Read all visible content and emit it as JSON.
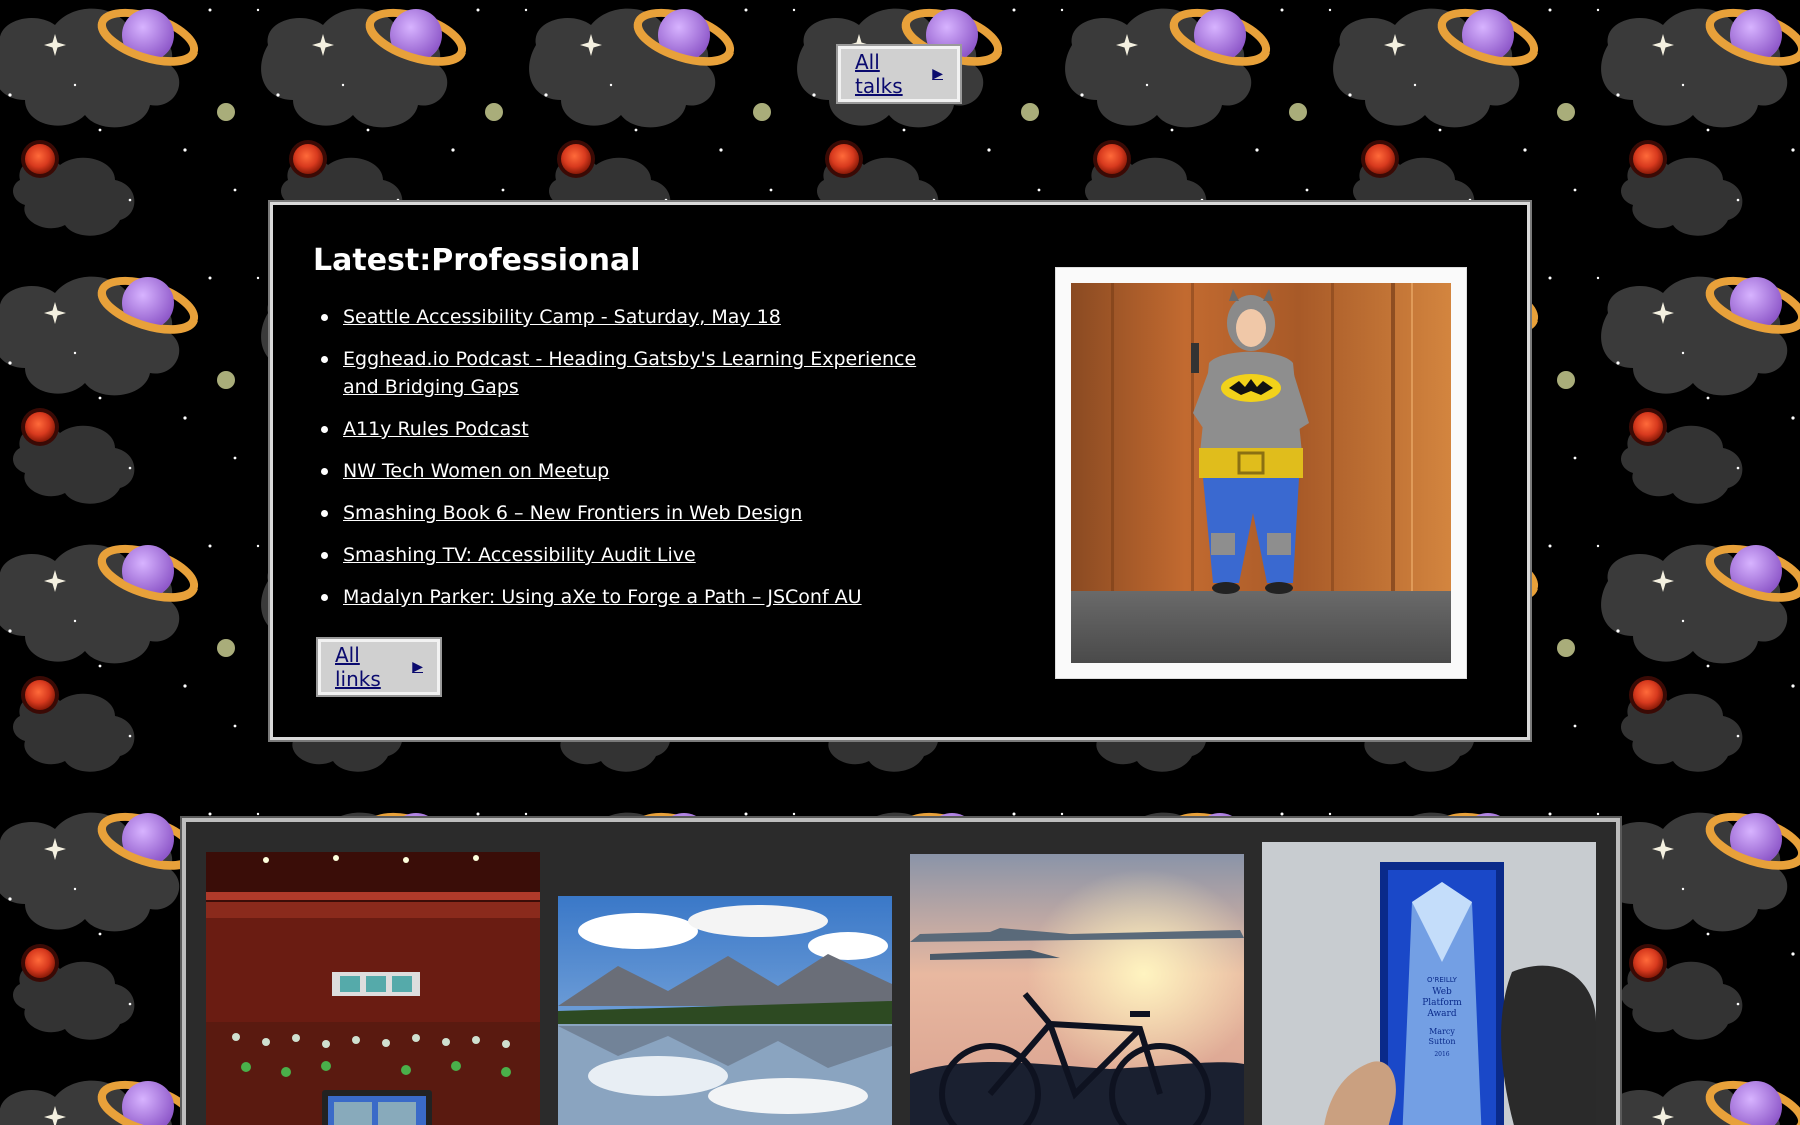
{
  "nav": {
    "all_talks_label": "All talks",
    "all_talks_arrow": "▶"
  },
  "latest": {
    "title": "Latest:Professional",
    "items": [
      {
        "label": "Seattle Accessibility Camp - Saturday, May 18"
      },
      {
        "label": "Egghead.io Podcast - Heading Gatsby's Learning Experience and Bridging Gaps"
      },
      {
        "label": "A11y Rules Podcast"
      },
      {
        "label": "NW Tech Women on Meetup"
      },
      {
        "label": "Smashing Book 6 – New Frontiers in Web Design"
      },
      {
        "label": "Smashing TV: Accessibility Audit Live"
      },
      {
        "label": "Madalyn Parker: Using aXe to Forge a Path – JSConf AU"
      }
    ],
    "all_links_label": "All links",
    "all_links_arrow": "▶",
    "photo_alt": "batman-costume-photo"
  },
  "gallery": {
    "images": [
      {
        "name": "theater-audience-photo"
      },
      {
        "name": "mountain-lake-photo"
      },
      {
        "name": "bicycle-sunset-photo"
      },
      {
        "name": "award-trophy-photo",
        "engraving": [
          "O'REILLY",
          "Web",
          "Platform",
          "Award",
          "Marcy",
          "Sutton",
          "2016"
        ]
      }
    ]
  },
  "colors": {
    "background": "#000000",
    "nebula": "#3a3a3a",
    "planet_purple": "#b07ee0",
    "planet_ring": "#e8a13a",
    "red_planet": "#d83a1e",
    "olive_moon": "#a9ad7a",
    "link_dark": "#0a0a6e",
    "button_bg": "#d0d0d0"
  }
}
